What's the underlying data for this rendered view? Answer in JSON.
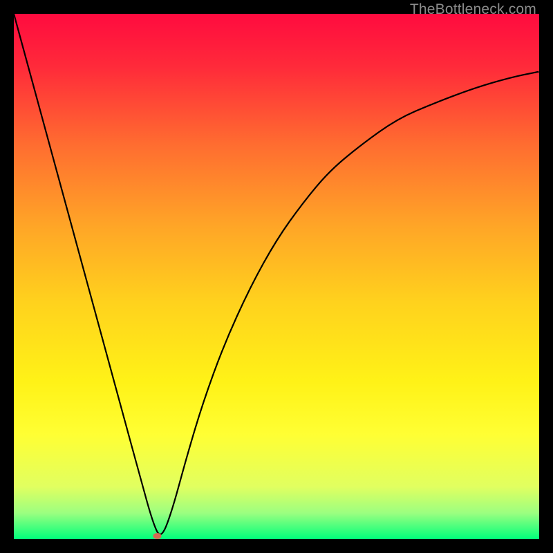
{
  "watermark": "TheBottleneck.com",
  "chart_data": {
    "type": "line",
    "title": "",
    "xlabel": "",
    "ylabel": "",
    "xlim": [
      0,
      100
    ],
    "ylim": [
      0,
      100
    ],
    "background_gradient": {
      "stops": [
        {
          "offset": 0.0,
          "color": "#ff0b3f"
        },
        {
          "offset": 0.1,
          "color": "#ff2a3a"
        },
        {
          "offset": 0.25,
          "color": "#ff6d30"
        },
        {
          "offset": 0.4,
          "color": "#ffa427"
        },
        {
          "offset": 0.55,
          "color": "#ffd21d"
        },
        {
          "offset": 0.7,
          "color": "#fff217"
        },
        {
          "offset": 0.8,
          "color": "#ffff33"
        },
        {
          "offset": 0.9,
          "color": "#e1ff60"
        },
        {
          "offset": 0.95,
          "color": "#9cff80"
        },
        {
          "offset": 1.0,
          "color": "#00ff7b"
        }
      ]
    },
    "series": [
      {
        "name": "bottleneck-curve",
        "x": [
          0,
          3,
          6,
          9,
          12,
          15,
          18,
          21,
          24,
          26.5,
          28,
          30,
          33,
          36,
          40,
          45,
          50,
          55,
          60,
          66,
          73,
          80,
          88,
          95,
          100
        ],
        "y": [
          100,
          89,
          78,
          67,
          56,
          45,
          34,
          23,
          12,
          3,
          0,
          5,
          16,
          26,
          37,
          48,
          57,
          64,
          70,
          75,
          80,
          83,
          86,
          88,
          89
        ]
      }
    ],
    "marker": {
      "x": 27.3,
      "y": 0.6,
      "color": "#d46a52"
    }
  }
}
